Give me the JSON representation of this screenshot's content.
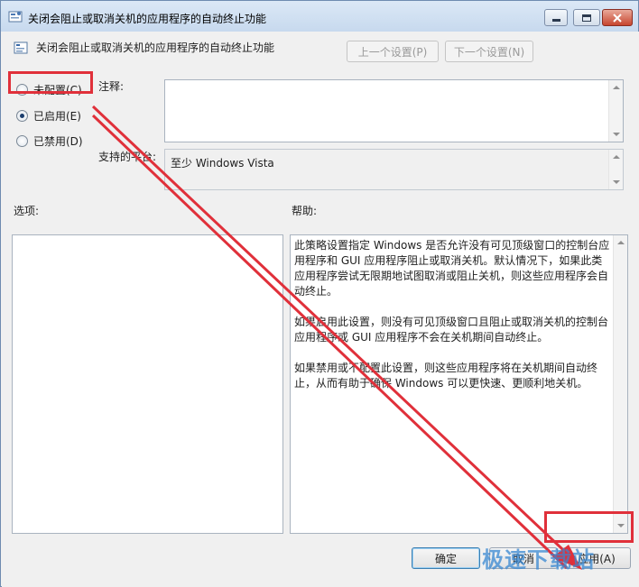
{
  "window": {
    "title": "关闭会阻止或取消关机的应用程序的自动终止功能",
    "controls": {
      "minimize": "minimize-icon",
      "maximize": "maximize-icon",
      "close": "close-icon"
    }
  },
  "policy": {
    "name": "关闭会阻止或取消关机的应用程序的自动终止功能"
  },
  "nav": {
    "prev": "上一个设置(P)",
    "next": "下一个设置(N)"
  },
  "state": {
    "options": [
      {
        "label": "未配置(C)",
        "selected": false
      },
      {
        "label": "已启用(E)",
        "selected": true
      },
      {
        "label": "已禁用(D)",
        "selected": false
      }
    ]
  },
  "labels": {
    "comment": "注释:",
    "platform": "支持的平台:",
    "options": "选项:",
    "help": "帮助:"
  },
  "platform_value": "至少 Windows Vista",
  "help": {
    "paragraphs": [
      "此策略设置指定 Windows 是否允许没有可见顶级窗口的控制台应用程序和 GUI 应用程序阻止或取消关机。默认情况下，如果此类应用程序尝试无限期地试图取消或阻止关机，则这些应用程序会自动终止。",
      "如果启用此设置，则没有可见顶级窗口且阻止或取消关机的控制台应用程序或 GUI 应用程序不会在关机期间自动终止。",
      "如果禁用或不配置此设置，则这些应用程序将在关机期间自动终止，从而有助于确保 Windows 可以更快速、更顺利地关机。"
    ]
  },
  "buttons": {
    "ok": "确定",
    "cancel": "取消",
    "apply": "应用(A)"
  },
  "watermark": "极速下载站",
  "colors": {
    "annotation": "#e0303a",
    "watermark": "#3787d2"
  }
}
